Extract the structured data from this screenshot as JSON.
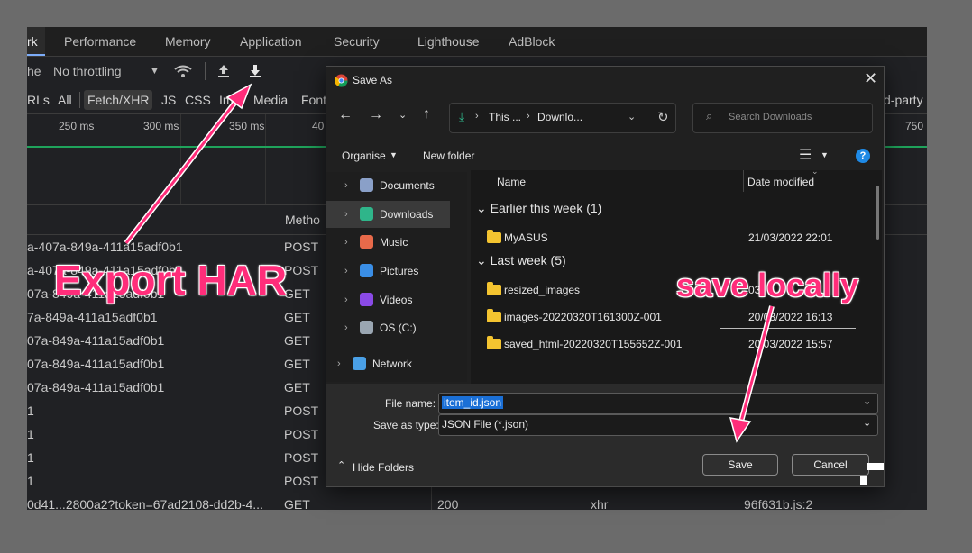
{
  "devtools": {
    "tabs": [
      "rk",
      "Performance",
      "Memory",
      "Application",
      "Security",
      "Lighthouse",
      "AdBlock"
    ],
    "toolbar": {
      "cache_label": "he",
      "throttling": "No throttling"
    },
    "filters": [
      "RLs",
      "All",
      "Fetch/XHR",
      "JS",
      "CSS",
      "Im",
      "Media",
      "Font",
      "d-party"
    ],
    "ticks": [
      "250 ms",
      "300 ms",
      "350 ms",
      "40",
      "750 ms"
    ],
    "columns": {
      "method": "Metho"
    },
    "rows": [
      {
        "name": "a-407a-849a-411a15adf0b1",
        "method": "POST"
      },
      {
        "name": "a-407a-849a-411a15adf0b1",
        "method": "POST"
      },
      {
        "name": "07a-849a-411a15adf0b1",
        "method": "GET"
      },
      {
        "name": "7a-849a-411a15adf0b1",
        "method": "GET"
      },
      {
        "name": "07a-849a-411a15adf0b1",
        "method": "GET"
      },
      {
        "name": "07a-849a-411a15adf0b1",
        "method": "GET"
      },
      {
        "name": "07a-849a-411a15adf0b1",
        "method": "GET"
      },
      {
        "name": "1",
        "method": "POST"
      },
      {
        "name": "1",
        "method": "POST"
      },
      {
        "name": "1",
        "method": "POST"
      },
      {
        "name": "1",
        "method": "POST"
      },
      {
        "name": "0d41...2800a2?token=67ad2108-dd2b-4...",
        "method": "GET",
        "status": "200",
        "type": "xhr",
        "initiator": "96f631b.js:2"
      }
    ]
  },
  "dialog": {
    "title": "Save As",
    "breadcrumb": [
      "This ...",
      "Downlo..."
    ],
    "search_placeholder": "Search Downloads",
    "organise": "Organise",
    "new_folder": "New folder",
    "nav": [
      {
        "label": "Documents",
        "icon": "documents-icon",
        "color": "#8aa0c8"
      },
      {
        "label": "Downloads",
        "icon": "downloads-icon",
        "color": "#2fb58a"
      },
      {
        "label": "Music",
        "icon": "music-icon",
        "color": "#e86a4a"
      },
      {
        "label": "Pictures",
        "icon": "pictures-icon",
        "color": "#3a8ee6"
      },
      {
        "label": "Videos",
        "icon": "videos-icon",
        "color": "#8a4ae6"
      },
      {
        "label": "OS (C:)",
        "icon": "drive-icon",
        "color": "#9aa6b2"
      },
      {
        "label": "Network",
        "icon": "network-icon",
        "color": "#4aa0e6"
      }
    ],
    "columns": {
      "name": "Name",
      "date": "Date modified"
    },
    "groups": [
      {
        "label": "Earlier this week (1)",
        "items": [
          {
            "name": "MyASUS",
            "date": "21/03/2022 22:01"
          }
        ]
      },
      {
        "label": "Last week (5)",
        "items": [
          {
            "name": "resized_images",
            "date": "03"
          },
          {
            "name": "images-20220320T161300Z-001",
            "date": "20/03/2022 16:13"
          },
          {
            "name": "saved_html-20220320T155652Z-001",
            "date": "20/03/2022 15:57"
          }
        ]
      }
    ],
    "file_name_label": "File name:",
    "file_name_value": "item_id.json",
    "save_type_label": "Save as type:",
    "save_type_value": "JSON File (*.json)",
    "hide_folders": "Hide Folders",
    "save_label": "Save",
    "cancel_label": "Cancel"
  },
  "annotations": {
    "export": "Export HAR",
    "save": "save locally",
    "color": "#ff2d7a"
  }
}
